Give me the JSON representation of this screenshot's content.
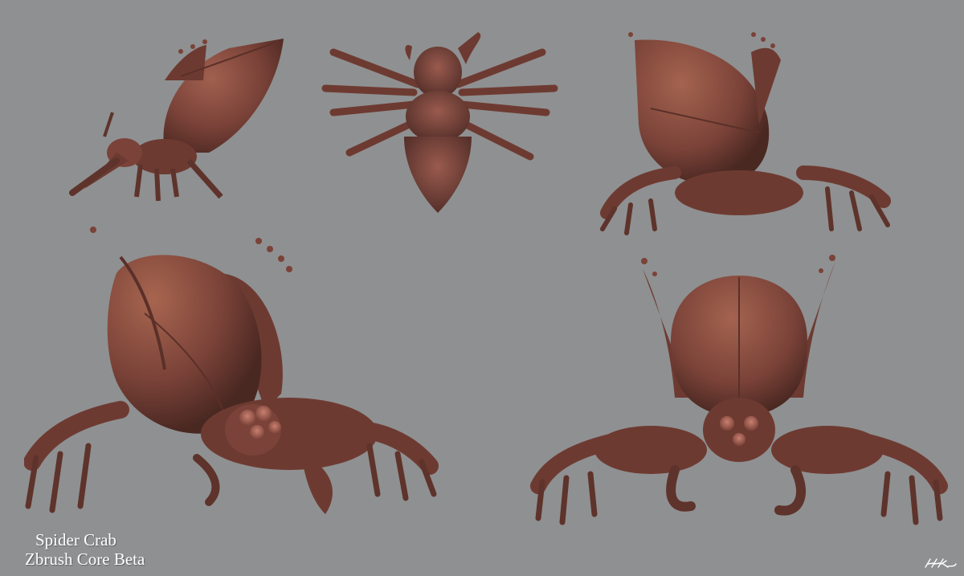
{
  "caption": {
    "title": "Spider Crab",
    "subtitle": "Zbrush Core Beta"
  },
  "signature": {
    "text": "HHK"
  },
  "palette": {
    "background": "#8f9091",
    "clay": "#7a4238",
    "clay_light": "#9a5a4e",
    "clay_dark": "#4f2a24"
  }
}
